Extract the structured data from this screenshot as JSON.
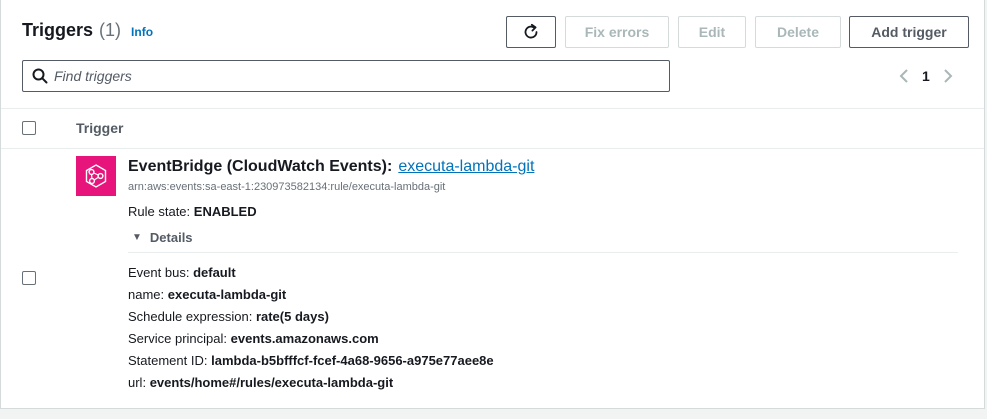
{
  "header": {
    "title": "Triggers",
    "count": "(1)",
    "info_label": "Info"
  },
  "toolbar": {
    "refresh_icon": "refresh-icon",
    "fix_errors_label": "Fix errors",
    "edit_label": "Edit",
    "delete_label": "Delete",
    "add_trigger_label": "Add trigger"
  },
  "search": {
    "placeholder": "Find triggers",
    "value": ""
  },
  "pagination": {
    "current_page": "1"
  },
  "table": {
    "column_header": "Trigger"
  },
  "trigger": {
    "source": "EventBridge (CloudWatch Events):",
    "rule_link": "executa-lambda-git",
    "arn": "arn:aws:events:sa-east-1:230973582134:rule/executa-lambda-git",
    "rule_state_label": "Rule state:",
    "rule_state_value": "ENABLED",
    "details_label": "Details",
    "details": [
      {
        "label": "Event bus:",
        "value": "default"
      },
      {
        "label": "name:",
        "value": "executa-lambda-git"
      },
      {
        "label": "Schedule expression:",
        "value": "rate(5 days)"
      },
      {
        "label": "Service principal:",
        "value": "events.amazonaws.com"
      },
      {
        "label": "Statement ID:",
        "value": "lambda-b5bfffcf-fcef-4a68-9656-a975e77aee8e"
      },
      {
        "label": "url:",
        "value": "events/home#/rules/executa-lambda-git"
      }
    ]
  },
  "colors": {
    "link": "#0073bb",
    "eventbridge_icon_bg": "#e7157b",
    "border": "#d5dbdb"
  }
}
